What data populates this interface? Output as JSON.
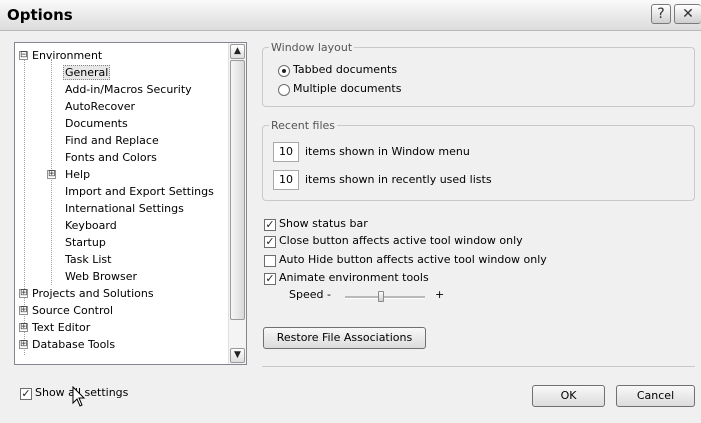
{
  "window": {
    "title": "Options",
    "help_glyph": "?",
    "close_glyph": "✕"
  },
  "tree": {
    "items": [
      {
        "label": "Environment",
        "expander": "⊟"
      },
      {
        "label": "General"
      },
      {
        "label": "Add-in/Macros Security"
      },
      {
        "label": "AutoRecover"
      },
      {
        "label": "Documents"
      },
      {
        "label": "Find and Replace"
      },
      {
        "label": "Fonts and Colors"
      },
      {
        "label": "Help",
        "expander": "⊞"
      },
      {
        "label": "Import and Export Settings"
      },
      {
        "label": "International Settings"
      },
      {
        "label": "Keyboard"
      },
      {
        "label": "Startup"
      },
      {
        "label": "Task List"
      },
      {
        "label": "Web Browser"
      },
      {
        "label": "Projects and Solutions",
        "expander": "⊞"
      },
      {
        "label": "Source Control",
        "expander": "⊞"
      },
      {
        "label": "Text Editor",
        "expander": "⊞"
      },
      {
        "label": "Database Tools",
        "expander": "⊞"
      }
    ],
    "selected": "General",
    "scroll_up": "▲",
    "scroll_down": "▼"
  },
  "window_layout": {
    "legend": "Window layout",
    "options": [
      {
        "label": "Tabbed documents",
        "selected": true
      },
      {
        "label": "Multiple documents",
        "selected": false
      }
    ]
  },
  "recent_files": {
    "legend": "Recent files",
    "window_menu_count": "10",
    "window_menu_label": "items shown in Window menu",
    "recent_lists_count": "10",
    "recent_lists_label": "items shown in recently used lists"
  },
  "options": [
    {
      "label": "Show status bar",
      "checked": true
    },
    {
      "label": "Close button affects active tool window only",
      "checked": true
    },
    {
      "label": "Auto Hide button affects active tool window only",
      "checked": false
    },
    {
      "label": "Animate environment tools",
      "checked": true
    }
  ],
  "speed": {
    "label": "Speed -",
    "plus": "+",
    "value_fraction": 0.45
  },
  "restore_button": "Restore File Associations",
  "show_all_settings": {
    "label": "Show all settings",
    "checked": true
  },
  "ok_button": "OK",
  "cancel_button": "Cancel",
  "check_glyph": "✓"
}
